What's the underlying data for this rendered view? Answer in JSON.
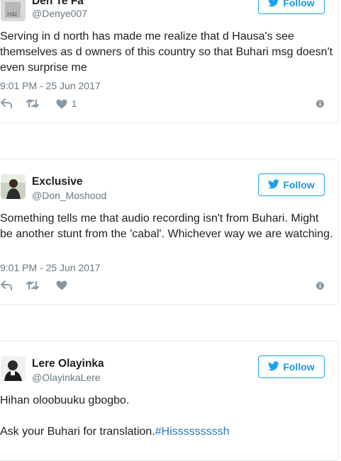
{
  "colors": {
    "accent": "#1da1f2",
    "muted": "#697882",
    "icon": "#8899a6",
    "border": "#e1e8ed"
  },
  "follow_label": "Follow",
  "tweets": [
    {
      "name": "Den Te Fa",
      "handle": "@Denye007",
      "text": "Serving in d north has made me realize that d Hausa's see themselves as d owners of this country so that Buhari msg doesn't even surprise me",
      "time": "9:01 PM - 25 Jun 2017",
      "like_count": "1"
    },
    {
      "name": "Exclusive",
      "handle": "@Don_Moshood",
      "text": "Something tells me that audio recording isn't from Buhari. Might be another stunt from the 'cabal'. Whichever way we are watching.",
      "time": "9:01 PM - 25 Jun 2017"
    },
    {
      "name": "Lere Olayinka",
      "handle": "@OlayinkaLere",
      "text_line1": "Hihan oloobuuku gbogbo.",
      "text_line2": "Ask your Buhari for translation.",
      "hashtag": "#Hisssssssssh"
    }
  ],
  "icons": {
    "reply": "reply-icon",
    "retweet": "retweet-icon",
    "like": "heart-icon",
    "info": "info-icon",
    "bird": "twitter-bird-icon"
  }
}
